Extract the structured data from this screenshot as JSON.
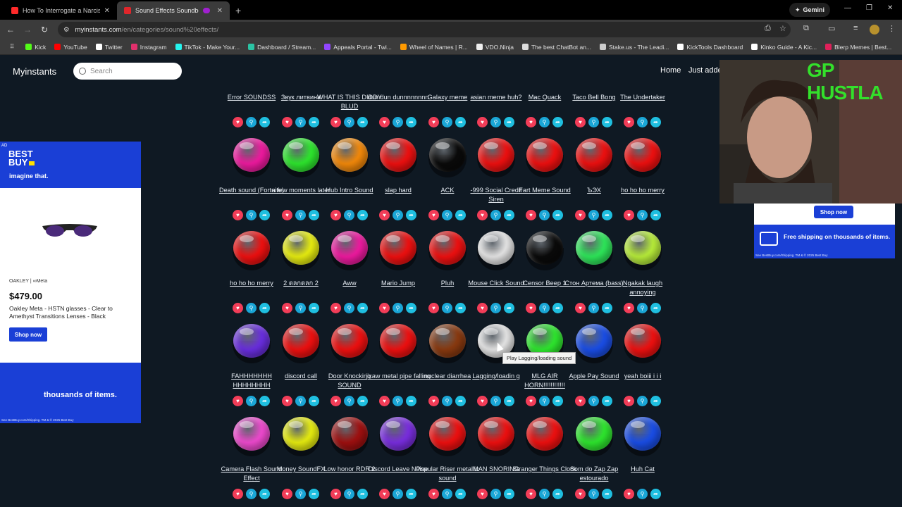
{
  "browser": {
    "tabs": [
      {
        "label": "How To Interrogate a Narcissist",
        "favicon_color": "#ff2a2a",
        "active": false
      },
      {
        "label": "Sound Effects Soundboard",
        "favicon_color": "#e0262b",
        "active": true
      }
    ],
    "gemini_label": "Gemini",
    "url_host": "myinstants.com",
    "url_path": "/en/categories/sound%20effects/",
    "bookmarks": [
      {
        "label": "Kick",
        "color": "#53fc18"
      },
      {
        "label": "YouTube",
        "color": "#ff0000"
      },
      {
        "label": "Twitter",
        "color": "#ffffff"
      },
      {
        "label": "Instagram",
        "color": "#e1306c"
      },
      {
        "label": "TikTok - Make Your...",
        "color": "#25f4ee"
      },
      {
        "label": "Dashboard / Stream...",
        "color": "#2bc4a4"
      },
      {
        "label": "Appeals Portal - Twi...",
        "color": "#9146ff"
      },
      {
        "label": "Wheel of Names | R...",
        "color": "#ff9a00"
      },
      {
        "label": "VDO.Ninja",
        "color": "#eeeeee"
      },
      {
        "label": "The best ChatBot an...",
        "color": "#dddddd"
      },
      {
        "label": "Stake.us - The Leadi...",
        "color": "#cccccc"
      },
      {
        "label": "KickTools Dashboard",
        "color": "#ffffff"
      },
      {
        "label": "Kinko Guide - A Kic...",
        "color": "#ffffff"
      },
      {
        "label": "Blerp Memes | Best...",
        "color": "#e0205a"
      }
    ]
  },
  "site": {
    "logo": "Myinstants",
    "search_placeholder": "Search",
    "nav": [
      "Home",
      "Just adde"
    ]
  },
  "sounds": [
    {
      "row": 0,
      "items": [
        {
          "name": "Error SOUNDSS",
          "color": "#ff2a2a"
        },
        {
          "name": "Звук литвина",
          "color": "#ff2a2a"
        },
        {
          "name": "WHAT IS THIS DIDDY BLUD",
          "color": "#ff2a2a"
        },
        {
          "name": "dun dun dunnnnnnnn",
          "color": "#ff2a2a"
        },
        {
          "name": "Galaxy meme",
          "color": "#ff2a2a"
        },
        {
          "name": "asian meme huh?",
          "color": "#ff2a2a"
        },
        {
          "name": "Mac Quack",
          "color": "#ff2a2a"
        },
        {
          "name": "Taco Bell Bong",
          "color": "#ff2a2a"
        },
        {
          "name": "The Undertaker",
          "color": "#ff2a2a"
        }
      ]
    },
    {
      "row": 1,
      "items": [
        {
          "name": "Death sound (Fortnite)",
          "color": "#f01aa0"
        },
        {
          "name": "a few moments later",
          "color": "#2ee82e"
        },
        {
          "name": "Hub Intro Sound",
          "color": "#f58a0a"
        },
        {
          "name": "slap hard",
          "color": "#f01010"
        },
        {
          "name": "ACK",
          "color": "#0a0a0a"
        },
        {
          "name": "-999 Social Credit Siren",
          "color": "#f01010"
        },
        {
          "name": "Fart Meme Sound",
          "color": "#f01010"
        },
        {
          "name": "ЪЭХ",
          "color": "#f01010"
        },
        {
          "name": "ho ho ho merry",
          "color": "#f01010"
        }
      ]
    },
    {
      "row": 2,
      "items": [
        {
          "name": "ho ho ho merry",
          "color": "#f01010"
        },
        {
          "name": "2 ตลกตลก 2",
          "color": "#e8ee10"
        },
        {
          "name": "Aww",
          "color": "#f01aa0"
        },
        {
          "name": "Mario Jump",
          "color": "#f01010"
        },
        {
          "name": "Pluh",
          "color": "#f01010"
        },
        {
          "name": "Mouse Click Sound",
          "color": "#e6e6e6"
        },
        {
          "name": "Censor Beep 1",
          "color": "#0a0a0a"
        },
        {
          "name": "Стон Артема (bass)",
          "color": "#2ee85a"
        },
        {
          "name": "Ngakak laugh annoying",
          "color": "#b8ee3a"
        }
      ]
    },
    {
      "row": 3,
      "items": [
        {
          "name": "FAHHHHHHH HHHHHHHH",
          "color": "#6a2ee0"
        },
        {
          "name": "discord call",
          "color": "#f01010"
        },
        {
          "name": "Door Knocking SOUND",
          "color": "#f01010"
        },
        {
          "name": "jixaw metal pipe falling",
          "color": "#f01010"
        },
        {
          "name": "nuclear diarrhea",
          "color": "#8a3a10"
        },
        {
          "name": "Lagging/loadin g",
          "color": "#e6e6e6"
        },
        {
          "name": "MLG AIR HORN!!!!!!!!!!!!",
          "color": "#2ee82e"
        },
        {
          "name": "Apple Pay Sound",
          "color": "#1a4ee8"
        },
        {
          "name": "yeah boiii i i i",
          "color": "#f01010"
        }
      ]
    },
    {
      "row": 4,
      "items": [
        {
          "name": "Camera Flash Sound Effect",
          "color": "#f04ad0"
        },
        {
          "name": "Money SoundFX",
          "color": "#e8ee10"
        },
        {
          "name": "Low honor RDR 2",
          "color": "#a01010"
        },
        {
          "name": "Discord Leave Noise",
          "color": "#7a2ee0"
        },
        {
          "name": "Popular Riser metallic sound",
          "color": "#f01010"
        },
        {
          "name": "MAN SNORING",
          "color": "#f01010"
        },
        {
          "name": "Stranger Things Clock",
          "color": "#f01010"
        },
        {
          "name": "Som do Zap Zap estourado",
          "color": "#2ee82e"
        },
        {
          "name": "Huh Cat",
          "color": "#1a4ee8"
        }
      ]
    }
  ],
  "tooltip": "Play Lagging/loading sound",
  "ad_left": {
    "badge": "AD",
    "brand": "BEST BUY",
    "tagline": "imagine that.",
    "partner": "OAKLEY | ∞Meta",
    "price": "$479.00",
    "description": "Oakley Meta - HSTN glasses - Clear to Amethyst Transitions Lenses - Black",
    "cta": "Shop now",
    "bottom_text": "thousands of items.",
    "fine_print": "See BestBuy.com/Shipping. TM & © 2025 Best Buy"
  },
  "ad_right": {
    "cta": "Shop now",
    "text": "Free shipping on thousands of items.",
    "fine_print": "See BestBuy.com/Shipping. TM & © 2025 Best Buy"
  },
  "overlay": {
    "webcam_text": "GP HUSTLA"
  }
}
